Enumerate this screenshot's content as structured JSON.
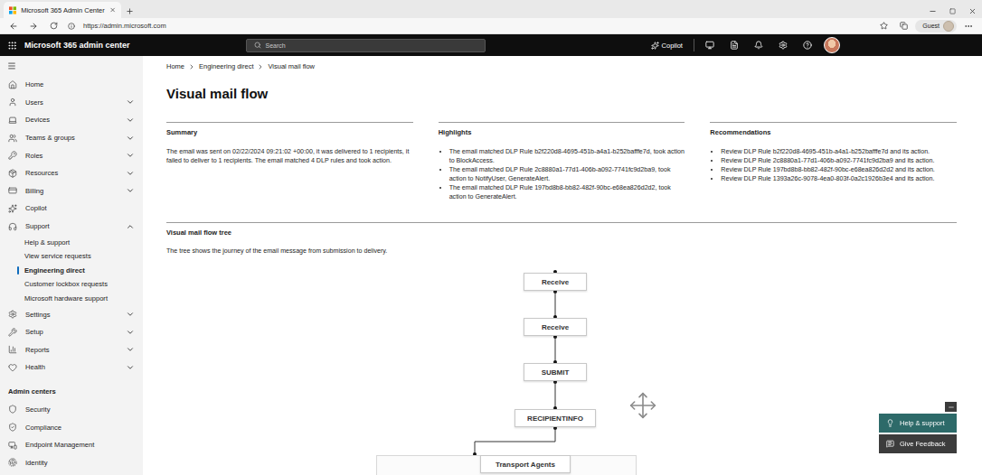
{
  "browser": {
    "tab_title": "Microsoft 365 Admin Center",
    "url": "https://admin.microsoft.com",
    "profile": "Guest"
  },
  "header": {
    "app_name": "Microsoft 365 admin center",
    "search_placeholder": "Search",
    "copilot": "Copilot"
  },
  "sidebar": {
    "items": [
      {
        "label": "Home",
        "kind": "item",
        "expandable": false,
        "expanded": false,
        "selected": false
      },
      {
        "label": "Users",
        "kind": "item",
        "expandable": true,
        "expanded": false,
        "selected": false
      },
      {
        "label": "Devices",
        "kind": "item",
        "expandable": true,
        "expanded": false,
        "selected": false
      },
      {
        "label": "Teams & groups",
        "kind": "item",
        "expandable": true,
        "expanded": false,
        "selected": false
      },
      {
        "label": "Roles",
        "kind": "item",
        "expandable": true,
        "expanded": false,
        "selected": false
      },
      {
        "label": "Resources",
        "kind": "item",
        "expandable": true,
        "expanded": false,
        "selected": false
      },
      {
        "label": "Billing",
        "kind": "item",
        "expandable": true,
        "expanded": false,
        "selected": false
      },
      {
        "label": "Copilot",
        "kind": "item",
        "expandable": false,
        "expanded": false,
        "selected": false
      },
      {
        "label": "Support",
        "kind": "item",
        "expandable": true,
        "expanded": true,
        "selected": false
      },
      {
        "label": "Help & support",
        "kind": "sub",
        "expandable": false,
        "expanded": false,
        "selected": false
      },
      {
        "label": "View service requests",
        "kind": "sub",
        "expandable": false,
        "expanded": false,
        "selected": false
      },
      {
        "label": "Engineering direct",
        "kind": "sub",
        "expandable": false,
        "expanded": false,
        "selected": true
      },
      {
        "label": "Customer lockbox requests",
        "kind": "sub",
        "expandable": false,
        "expanded": false,
        "selected": false
      },
      {
        "label": "Microsoft hardware support",
        "kind": "sub",
        "expandable": false,
        "expanded": false,
        "selected": false
      },
      {
        "label": "Settings",
        "kind": "item",
        "expandable": true,
        "expanded": false,
        "selected": false
      },
      {
        "label": "Setup",
        "kind": "item",
        "expandable": true,
        "expanded": false,
        "selected": false
      },
      {
        "label": "Reports",
        "kind": "item",
        "expandable": true,
        "expanded": false,
        "selected": false
      },
      {
        "label": "Health",
        "kind": "item",
        "expandable": true,
        "expanded": false,
        "selected": false
      },
      {
        "label": "Admin centers",
        "kind": "heading",
        "expandable": false,
        "expanded": false,
        "selected": false
      },
      {
        "label": "Security",
        "kind": "item",
        "expandable": false,
        "expanded": false,
        "selected": false
      },
      {
        "label": "Compliance",
        "kind": "item",
        "expandable": false,
        "expanded": false,
        "selected": false
      },
      {
        "label": "Endpoint Management",
        "kind": "item",
        "expandable": false,
        "expanded": false,
        "selected": false
      },
      {
        "label": "Identity",
        "kind": "item",
        "expandable": false,
        "expanded": false,
        "selected": false
      }
    ]
  },
  "breadcrumb": [
    "Home",
    "Engineering direct",
    "Visual mail flow"
  ],
  "page_title": "Visual mail flow",
  "summary": {
    "title": "Summary",
    "text": "The email was sent on 02/22/2024 09:21:02 +00:00, it was delivered to 1 recipients, it failed to deliver to 1 recipients. The email matched 4 DLP rules and took action."
  },
  "highlights": {
    "title": "Highlights",
    "items": [
      "The email matched DLP Rule b2f220d8-4695-451b-a4a1-b252bafffe7d, took action to BlockAccess.",
      "The email matched DLP Rule 2c8880a1-77d1-406b-a092-7741fc9d2ba9, took action to NotifyUser, GenerateAlert.",
      "The email matched DLP Rule 197bd8b8-bb82-482f-90bc-e68ea826d2d2, took action to GenerateAlert."
    ]
  },
  "recommendations": {
    "title": "Recommendations",
    "items": [
      "Review DLP Rule b2f220d8-4695-451b-a4a1-b252bafffe7d and its action.",
      "Review DLP Rule 2c8880a1-77d1-406b-a092-7741fc9d2ba9 and its action.",
      "Review DLP Rule 197bd8b8-bb82-482f-90bc-e68ea826d2d2 and its action.",
      "Review DLP Rule 1393a26c-9078-4ea0-803f-0a2c1926b3e4 and its action."
    ]
  },
  "tree": {
    "title": "Visual mail flow tree",
    "description": "The tree shows the journey of the email message from submission to delivery.",
    "nodes": [
      "Receive",
      "Receive",
      "SUBMIT",
      "RECIPIENTINFO",
      "Transport Agents"
    ]
  },
  "floating": {
    "buttons": [
      "Help & support",
      "Give Feedback"
    ]
  }
}
